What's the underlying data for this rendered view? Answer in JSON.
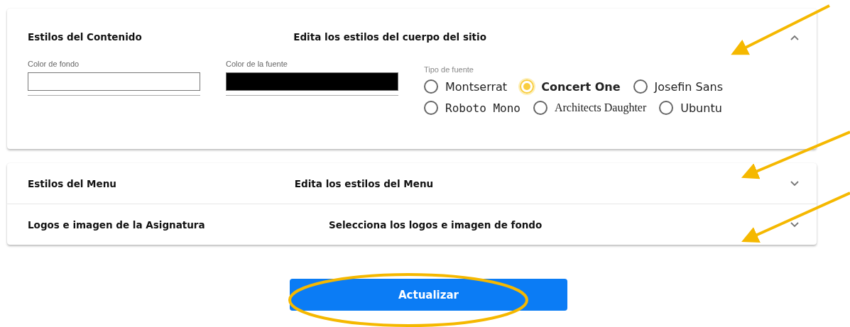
{
  "panels": [
    {
      "title": "Estilos del Contenido",
      "description": "Edita los estilos del cuerpo del sitio",
      "expanded": true,
      "fields": [
        {
          "label": "Color de fondo",
          "color": "#ffffff"
        },
        {
          "label": "Color de la fuente",
          "color": "#000000"
        }
      ],
      "font_group": {
        "label": "Tipo de fuente",
        "options": [
          {
            "label": "Montserrat",
            "selected": false
          },
          {
            "label": "Concert One",
            "selected": true
          },
          {
            "label": "Josefin Sans",
            "selected": false
          },
          {
            "label": "Roboto Mono",
            "selected": false
          },
          {
            "label": "Architects Daughter",
            "selected": false
          },
          {
            "label": "Ubuntu",
            "selected": false
          }
        ]
      }
    },
    {
      "title": "Estilos del Menu",
      "description": "Edita los estilos del Menu",
      "expanded": false
    },
    {
      "title": "Logos e imagen de la Asignatura",
      "description": "Selecciona los logos e imagen de fondo",
      "expanded": false
    }
  ],
  "button": {
    "label": "Actualizar"
  },
  "annotations": [
    {
      "kind": "arrow"
    },
    {
      "kind": "arrow"
    },
    {
      "kind": "arrow"
    },
    {
      "kind": "ellipse"
    }
  ]
}
